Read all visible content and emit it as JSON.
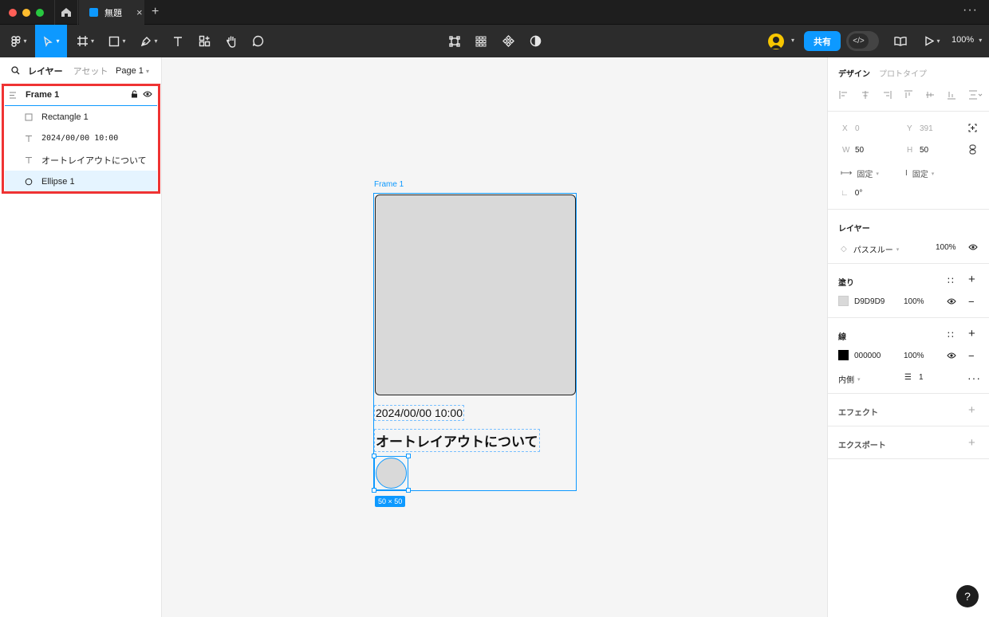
{
  "titlebar": {
    "file_tab_title": "無題",
    "new_tab": "+",
    "close_tab": "×"
  },
  "toolbar": {
    "share_label": "共有",
    "zoom_label": "100%"
  },
  "left_panel": {
    "tab_layers": "レイヤー",
    "tab_assets": "アセット",
    "page_selector": "Page 1",
    "layers": [
      {
        "name": "Frame 1",
        "icon": "frame-icon"
      },
      {
        "name": "Rectangle 1",
        "icon": "rectangle-icon"
      },
      {
        "name": "2024/00/00 10:00",
        "icon": "text-icon"
      },
      {
        "name": "オートレイアウトについて",
        "icon": "text-icon"
      },
      {
        "name": "Ellipse 1",
        "icon": "ellipse-icon"
      }
    ]
  },
  "canvas": {
    "frame_label": "Frame 1",
    "date_text": "2024/00/00 10:00",
    "heading_text": "オートレイアウトについて",
    "size_badge": "50 × 50"
  },
  "right_panel": {
    "tab_design": "デザイン",
    "tab_prototype": "プロトタイプ",
    "x_label": "X",
    "x_value": "0",
    "y_label": "Y",
    "y_value": "391",
    "w_label": "W",
    "w_value": "50",
    "h_label": "H",
    "h_value": "50",
    "h_sizing": "固定",
    "v_sizing": "固定",
    "rotation": "0°",
    "layer_title": "レイヤー",
    "blend_mode": "パススルー",
    "layer_opacity": "100%",
    "fill_title": "塗り",
    "fill_hex": "D9D9D9",
    "fill_opacity": "100%",
    "fill_color": "#d9d9d9",
    "stroke_title": "線",
    "stroke_hex": "000000",
    "stroke_opacity": "100%",
    "stroke_color": "#000000",
    "stroke_position": "内側",
    "stroke_weight": "1",
    "effects_title": "エフェクト",
    "export_title": "エクスポート"
  },
  "help_label": "?",
  "colors": {
    "accent": "#0d99ff",
    "highlight_border": "#ef3333",
    "selected_row": "#e5f4ff"
  }
}
